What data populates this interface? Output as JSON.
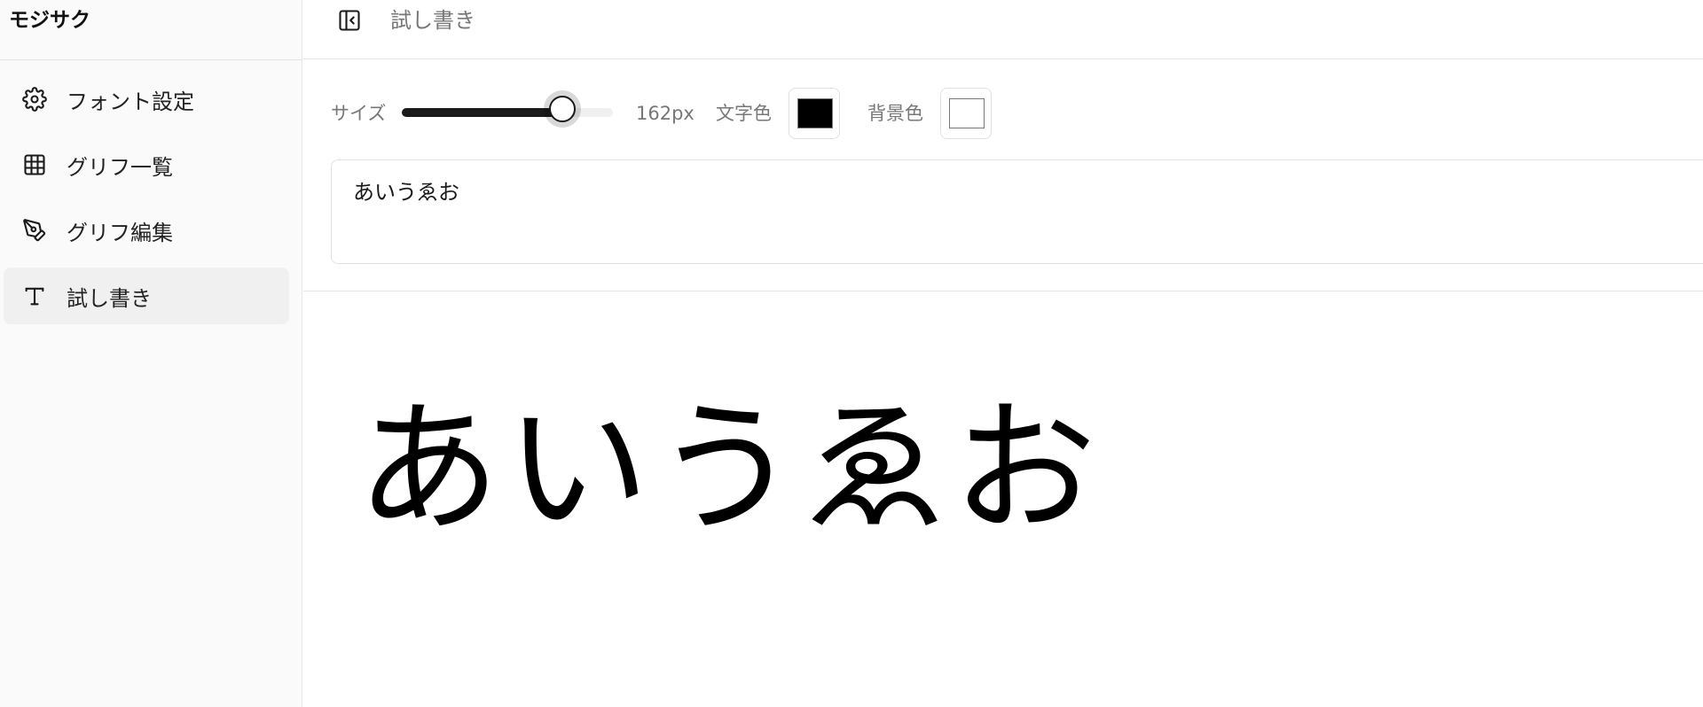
{
  "app": {
    "title": "モジサク"
  },
  "sidebar": {
    "items": [
      {
        "label": "フォント設定",
        "icon": "gear-icon",
        "active": false
      },
      {
        "label": "グリフ一覧",
        "icon": "grid-icon",
        "active": false
      },
      {
        "label": "グリフ編集",
        "icon": "pen-tool-icon",
        "active": false
      },
      {
        "label": "試し書き",
        "icon": "type-icon",
        "active": true
      }
    ]
  },
  "header": {
    "title": "試し書き"
  },
  "toolbar": {
    "size_label": "サイズ",
    "size_value": 162,
    "size_display": "162px",
    "size_slider_fraction": 0.76,
    "text_color_label": "文字色",
    "text_color": "#000000",
    "bg_color_label": "背景色",
    "bg_color": "#ffffff"
  },
  "sample": {
    "text": "あいうゑお"
  },
  "preview": {
    "text": "あいうゑお",
    "color": "#000000",
    "background": "#ffffff"
  }
}
